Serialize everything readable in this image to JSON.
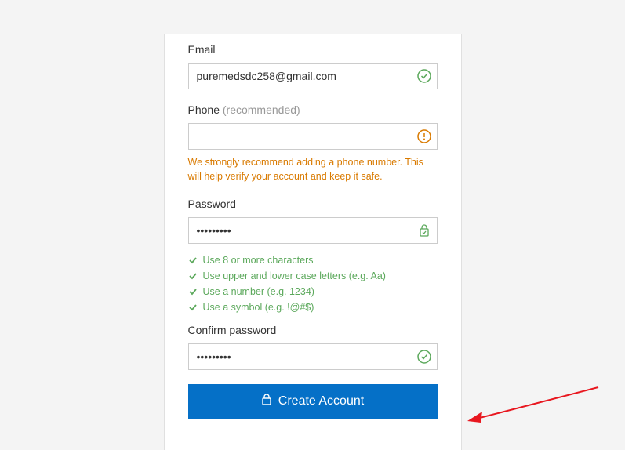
{
  "form": {
    "email": {
      "label": "Email",
      "value": "puremedsdc258@gmail.com",
      "status": "valid"
    },
    "phone": {
      "label_main": "Phone",
      "label_secondary": " (recommended)",
      "value": "",
      "status": "warning",
      "help_text": "We strongly recommend adding a phone number. This will help verify your account and keep it safe."
    },
    "password": {
      "label": "Password",
      "value": "•••••••••",
      "status": "valid-lock",
      "requirements": [
        "Use 8 or more characters",
        "Use upper and lower case letters (e.g. Aa)",
        "Use a number (e.g. 1234)",
        "Use a symbol (e.g. !@#$)"
      ]
    },
    "confirm_password": {
      "label": "Confirm password",
      "value": "•••••••••",
      "status": "valid"
    },
    "submit_label": "Create Account"
  },
  "colors": {
    "success": "#5ba85b",
    "warning": "#d97a00",
    "primary": "#0570c7"
  }
}
